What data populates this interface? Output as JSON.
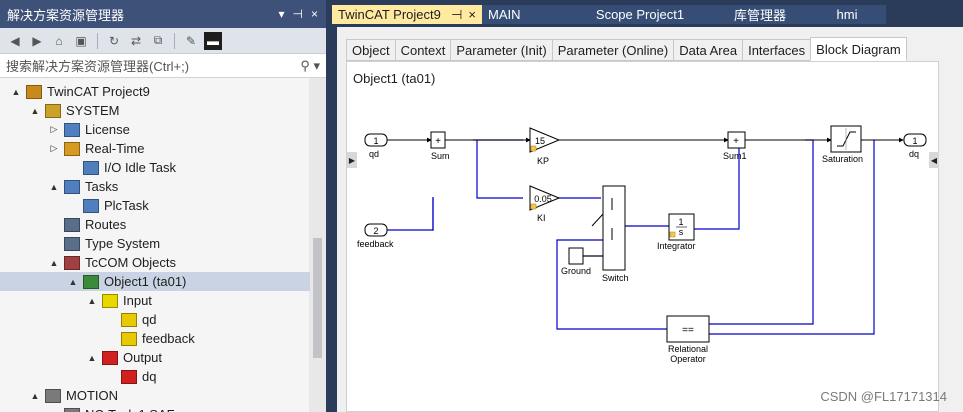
{
  "solution_explorer": {
    "title": "解决方案资源管理器",
    "search_placeholder": "搜索解决方案资源管理器(Ctrl+;)",
    "tree": [
      {
        "label": "TwinCAT Project9",
        "level": 0,
        "expand": "▲",
        "icon": "project-icon",
        "icolor": "#c88a1c"
      },
      {
        "label": "SYSTEM",
        "level": 1,
        "expand": "▲",
        "icon": "system-icon",
        "icolor": "#c9a227"
      },
      {
        "label": "License",
        "level": 2,
        "expand": "▷",
        "icon": "license-icon",
        "icolor": "#4f7fbf"
      },
      {
        "label": "Real-Time",
        "level": 2,
        "expand": "▷",
        "icon": "realtime-icon",
        "icolor": "#d69a20"
      },
      {
        "label": "I/O Idle Task",
        "level": 3,
        "expand": "",
        "icon": "task-icon",
        "icolor": "#4f7fbf"
      },
      {
        "label": "Tasks",
        "level": 2,
        "expand": "▲",
        "icon": "tasks-icon",
        "icolor": "#4f7fbf"
      },
      {
        "label": "PlcTask",
        "level": 3,
        "expand": "",
        "icon": "task-icon",
        "icolor": "#4f7fbf"
      },
      {
        "label": "Routes",
        "level": 2,
        "expand": "",
        "icon": "routes-icon",
        "icolor": "#5a6e8a"
      },
      {
        "label": "Type System",
        "level": 2,
        "expand": "",
        "icon": "typesystem-icon",
        "icolor": "#5a6e8a"
      },
      {
        "label": "TcCOM Objects",
        "level": 2,
        "expand": "▲",
        "icon": "tccom-icon",
        "icolor": "#a04040"
      },
      {
        "label": "Object1 (ta01)",
        "level": 3,
        "expand": "▲",
        "icon": "object-icon",
        "icolor": "#3a8a3a",
        "selected": true
      },
      {
        "label": "Input",
        "level": 4,
        "expand": "▲",
        "icon": "input-folder-icon",
        "icolor": "#e8d800"
      },
      {
        "label": "qd",
        "level": 5,
        "expand": "",
        "icon": "input-var-icon",
        "icolor": "#e8c800"
      },
      {
        "label": "feedback",
        "level": 5,
        "expand": "",
        "icon": "input-var-icon",
        "icolor": "#e8c800"
      },
      {
        "label": "Output",
        "level": 4,
        "expand": "▲",
        "icon": "output-folder-icon",
        "icolor": "#d02020"
      },
      {
        "label": "dq",
        "level": 5,
        "expand": "",
        "icon": "output-var-icon",
        "icolor": "#d02020"
      },
      {
        "label": "MOTION",
        "level": 1,
        "expand": "▲",
        "icon": "motion-icon",
        "icolor": "#7a7a7a"
      },
      {
        "label": "NC-Task 1 SAF",
        "level": 2,
        "expand": "▲",
        "icon": "nctask-icon",
        "icolor": "#7a7a7a"
      }
    ]
  },
  "doc_tabs": {
    "active": {
      "label": "TwinCAT Project9",
      "pin": "⊣",
      "close": "×"
    },
    "others": [
      "MAIN",
      "Scope Project1",
      "库管理器",
      "hmi"
    ]
  },
  "inner_tabs": [
    "Object",
    "Context",
    "Parameter (Init)",
    "Parameter (Online)",
    "Data Area",
    "Interfaces",
    "Block Diagram"
  ],
  "active_inner_tab": "Block Diagram",
  "object_label": "Object1 (ta01)",
  "diagram": {
    "blocks": {
      "qd_port": "1",
      "qd_label": "qd",
      "feedback_port": "2",
      "feedback_label": "feedback",
      "sum_sign": "+",
      "sum_label": "Sum",
      "kp_value": "15",
      "kp_label": "KP",
      "ki_value": "0.05",
      "ki_label": "KI",
      "sum1_sign": "+",
      "sum1_label": "Sum1",
      "saturation_label": "Saturation",
      "dq_port": "1",
      "dq_label": "dq",
      "integrator_num": "1",
      "integrator_den": "s",
      "integrator_label": "Integrator",
      "ground_label": "Ground",
      "switch_label": "Switch",
      "relop_symbol": "==",
      "relop_label1": "Relational",
      "relop_label2": "Operator"
    },
    "line_color": "#0000cc"
  },
  "watermark": "CSDN @FL17171314"
}
